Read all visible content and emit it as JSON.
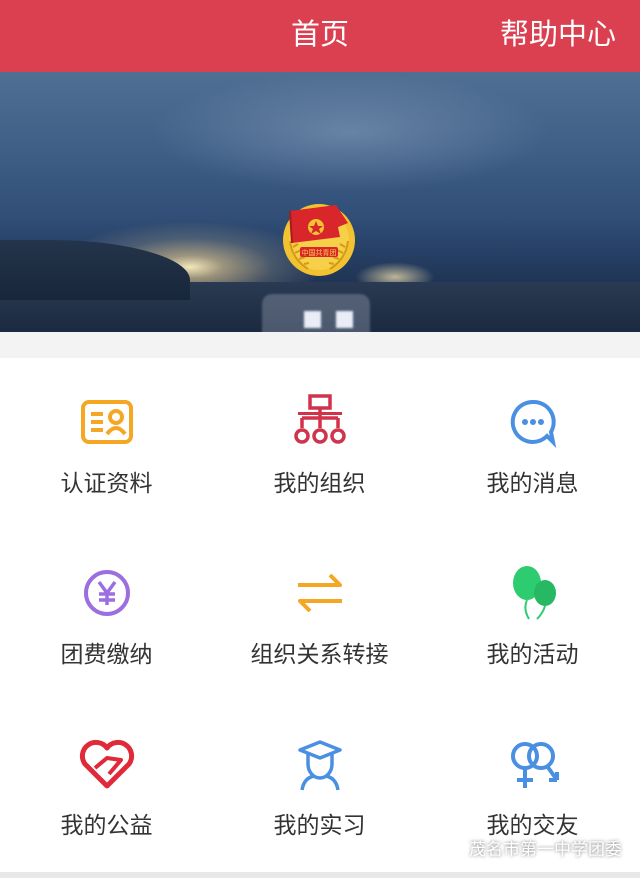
{
  "header": {
    "title": "首页",
    "help": "帮助中心",
    "bg_color": "#db4051"
  },
  "profile": {
    "emblem": "youth-league-emblem",
    "name": "██"
  },
  "menu": [
    {
      "label": "认证资料",
      "icon": "id-card-icon",
      "color": "#f5a623"
    },
    {
      "label": "我的组织",
      "icon": "org-chart-icon",
      "color": "#d0334a"
    },
    {
      "label": "我的消息",
      "icon": "chat-bubble-icon",
      "color": "#4a90e2"
    },
    {
      "label": "团费缴纳",
      "icon": "yuan-coin-icon",
      "color": "#9b6fe0"
    },
    {
      "label": "组织关系转接",
      "icon": "transfer-arrows-icon",
      "color": "#f5a623"
    },
    {
      "label": "我的活动",
      "icon": "balloons-icon",
      "color": "#2ecc71"
    },
    {
      "label": "我的公益",
      "icon": "heart-hand-icon",
      "color": "#e02a3a"
    },
    {
      "label": "我的实习",
      "icon": "graduate-icon",
      "color": "#4a90e2"
    },
    {
      "label": "我的交友",
      "icon": "gender-symbols-icon",
      "color": "#4a90e2"
    }
  ],
  "watermark": "茂名市第一中学团委"
}
